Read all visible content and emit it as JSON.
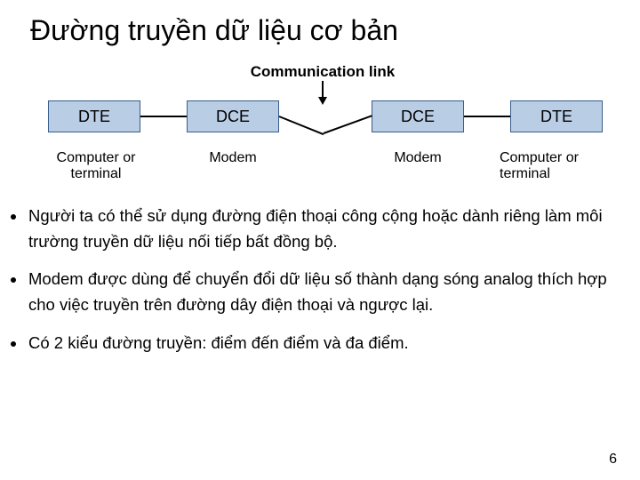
{
  "title": "Đường truyền dữ liệu cơ bản",
  "comm_label": "Communication link",
  "boxes": {
    "b1": "DTE",
    "b2": "DCE",
    "b3": "DCE",
    "b4": "DTE"
  },
  "labels": {
    "l1a": "Computer or",
    "l1b": "terminal",
    "l2": "Modem",
    "l3": "Modem",
    "l4a": "Computer or",
    "l4b": "terminal"
  },
  "bullets": {
    "b1": "Người ta có thể sử dụng đường điện thoại công cộng hoặc dành riêng làm môi trường truyền dữ liệu nối tiếp bất đồng bộ.",
    "b2": "Modem được dùng để chuyển đổi dữ liệu số thành dạng sóng analog thích hợp cho việc truyền trên đường dây điện thoại và ngược lại.",
    "b3": "Có 2 kiểu đường truyền: điểm đến điểm và đa điểm."
  },
  "pagenum": "6"
}
